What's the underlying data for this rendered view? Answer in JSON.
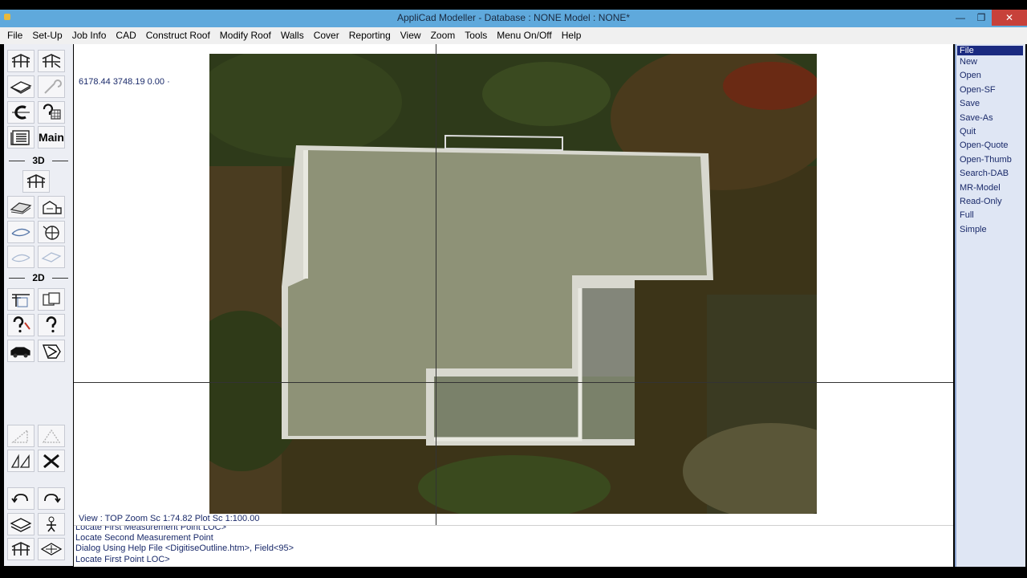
{
  "window": {
    "title": "AppliCad Modeller - Database : NONE   Model : NONE*",
    "minimize": "—",
    "maximize": "❐",
    "close": "✕"
  },
  "menu": [
    "File",
    "Set-Up",
    "Job Info",
    "CAD",
    "Construct Roof",
    "Modify Roof",
    "Walls",
    "Cover",
    "Reporting",
    "View",
    "Zoom",
    "Tools",
    "Menu On/Off",
    "Help"
  ],
  "toolbar": {
    "main_label": "Main",
    "section_3d": "3D",
    "section_2d": "2D"
  },
  "canvas": {
    "coords": "6178.44   3748.19   0.00  ·",
    "view_status": "View : TOP  Zoom Sc 1:74.82   Plot Sc 1:100.00"
  },
  "command_log": [
    "Locate First Measurement Point LOC>",
    "Locate Second Measurement Point",
    "Dialog Using Help File <DigitiseOutline.htm>, Field<95>",
    "Locate First Point LOC>"
  ],
  "side_menu": {
    "selected": "File",
    "items": [
      "New",
      "Open",
      "Open-SF",
      "Save",
      "Save-As",
      "Quit",
      "Open-Quote",
      "Open-Thumb",
      "Search-DAB",
      "MR-Model",
      "Read-Only",
      "Full",
      "Simple"
    ]
  }
}
